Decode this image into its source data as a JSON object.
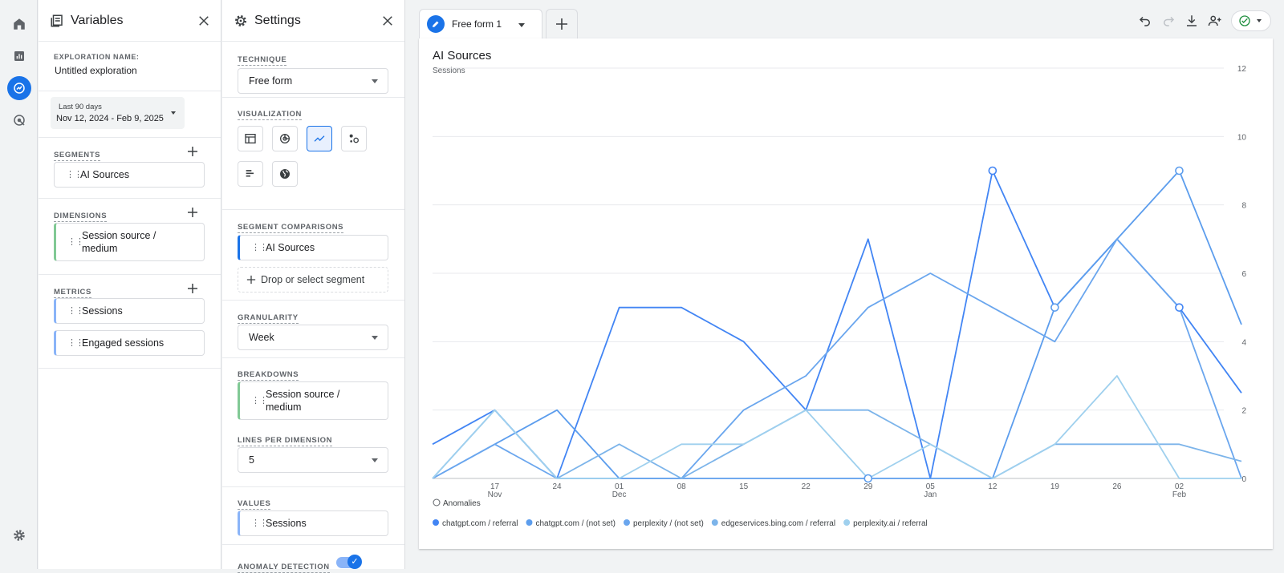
{
  "variables_panel": {
    "title": "Variables",
    "exploration_name_label": "EXPLORATION NAME:",
    "exploration_name": "Untitled exploration",
    "date_range_label": "Last 90 days",
    "date_range_value": "Nov 12, 2024 - Feb 9, 2025",
    "segments_label": "SEGMENTS",
    "segments": [
      "AI Sources"
    ],
    "dimensions_label": "DIMENSIONS",
    "dimensions": [
      "Session source /",
      "medium"
    ],
    "metrics_label": "METRICS",
    "metrics": [
      "Sessions",
      "Engaged sessions"
    ]
  },
  "settings_panel": {
    "title": "Settings",
    "technique_label": "TECHNIQUE",
    "technique_value": "Free form",
    "visualization_label": "VISUALIZATION",
    "segment_comparisons_label": "SEGMENT COMPARISONS",
    "segment_comparison": "AI Sources",
    "drop_segment": "Drop or select segment",
    "granularity_label": "GRANULARITY",
    "granularity_value": "Week",
    "breakdowns_label": "BREAKDOWNS",
    "breakdown_line1": "Session source /",
    "breakdown_line2": "medium",
    "lines_per_dimension_label": "LINES PER DIMENSION",
    "lines_per_dimension_value": "5",
    "values_label": "VALUES",
    "values_value": "Sessions",
    "anomaly_label": "ANOMALY DETECTION"
  },
  "tab": {
    "label": "Free form 1"
  },
  "chart_title": "AI Sources",
  "colors": {
    "accent": "#1a73e8",
    "series": [
      "#4285f4",
      "#5c9ded",
      "#6aa6ee",
      "#7cb4ea",
      "#9fd0ee"
    ]
  },
  "chart_data": {
    "type": "line",
    "title": "AI Sources",
    "ylabel": "Sessions",
    "ylim": [
      0,
      12
    ],
    "y_ticks": [
      "0",
      "2",
      "4",
      "6",
      "8",
      "10",
      "12"
    ],
    "x_labels": [
      {
        "top": "",
        "bottom": ""
      },
      {
        "top": "17",
        "bottom": "Nov"
      },
      {
        "top": "24",
        "bottom": ""
      },
      {
        "top": "01",
        "bottom": "Dec"
      },
      {
        "top": "08",
        "bottom": ""
      },
      {
        "top": "15",
        "bottom": ""
      },
      {
        "top": "22",
        "bottom": ""
      },
      {
        "top": "29",
        "bottom": ""
      },
      {
        "top": "05",
        "bottom": "Jan"
      },
      {
        "top": "12",
        "bottom": ""
      },
      {
        "top": "19",
        "bottom": ""
      },
      {
        "top": "26",
        "bottom": ""
      },
      {
        "top": "02",
        "bottom": "Feb"
      },
      {
        "top": "",
        "bottom": ""
      }
    ],
    "anomalies_label": "Anomalies",
    "series": [
      {
        "name": "chatgpt.com / referral",
        "values": [
          1,
          2,
          0,
          5,
          5,
          4,
          2,
          7,
          0,
          9,
          5,
          7,
          5,
          2.5
        ]
      },
      {
        "name": "chatgpt.com / (not set)",
        "values": [
          0,
          1,
          2,
          0,
          0,
          0,
          0,
          0,
          0,
          0,
          5,
          7,
          9,
          4.5
        ]
      },
      {
        "name": "perplexity / (not set)",
        "values": [
          0,
          1,
          0,
          0,
          0,
          2,
          3,
          5,
          6,
          5,
          4,
          7,
          5,
          0
        ]
      },
      {
        "name": "edgeservices.bing.com / referral",
        "values": [
          0,
          2,
          0,
          1,
          0,
          1,
          2,
          2,
          1,
          0,
          1,
          1,
          1,
          0.5
        ]
      },
      {
        "name": "perplexity.ai / referral",
        "values": [
          0,
          2,
          0,
          0,
          1,
          1,
          2,
          0,
          1,
          0,
          1,
          3,
          0,
          0
        ]
      }
    ],
    "anomaly_points": [
      [
        0,
        9
      ],
      [
        0,
        12
      ],
      [
        1,
        7
      ],
      [
        1,
        10
      ],
      [
        1,
        12
      ]
    ]
  }
}
